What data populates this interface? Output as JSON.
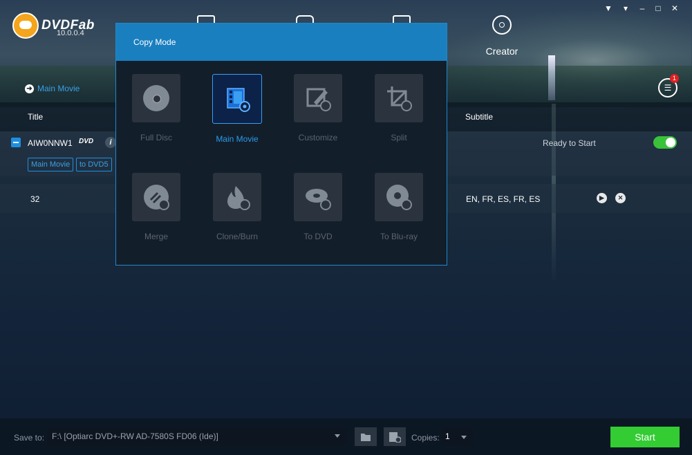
{
  "app": {
    "name": "DVDFab",
    "version": "10.0.0.4"
  },
  "top_nav": {
    "creator_label": "Creator"
  },
  "window_controls": [
    "▼",
    "▾",
    "–",
    "□",
    "✕"
  ],
  "breadcrumb": {
    "label": "Main Movie"
  },
  "queue": {
    "badge": "1"
  },
  "table": {
    "headers": {
      "title": "Title",
      "subtitle": "Subtitle"
    },
    "title_row": {
      "name": "AIW0NNW1",
      "disc_type": "DVD",
      "info": "i",
      "tags": [
        "Main Movie",
        "to DVD5"
      ],
      "status": "Ready to Start"
    },
    "chapter_row": {
      "number": "32",
      "subtitles": "EN, FR, ES, FR, ES"
    }
  },
  "copy_mode": {
    "title": "Copy Mode",
    "modes": [
      {
        "label": "Full Disc",
        "icon": "full-disc-icon"
      },
      {
        "label": "Main Movie",
        "icon": "main-movie-icon",
        "active": true
      },
      {
        "label": "Customize",
        "icon": "customize-icon"
      },
      {
        "label": "Split",
        "icon": "split-icon"
      },
      {
        "label": "Merge",
        "icon": "merge-icon"
      },
      {
        "label": "Clone/Burn",
        "icon": "clone-burn-icon"
      },
      {
        "label": "To DVD",
        "icon": "to-dvd-icon"
      },
      {
        "label": "To Blu-ray",
        "icon": "to-bluray-icon"
      }
    ]
  },
  "bottom_bar": {
    "save_to_label": "Save to:",
    "save_path": "F:\\ [Optiarc DVD+-RW AD-7580S FD06 (Ide)]",
    "copies_label": "Copies:",
    "copies_value": "1",
    "start_label": "Start"
  },
  "colors": {
    "accent": "#1a7fbf",
    "start": "#33cc33",
    "link": "#39a0e6"
  }
}
